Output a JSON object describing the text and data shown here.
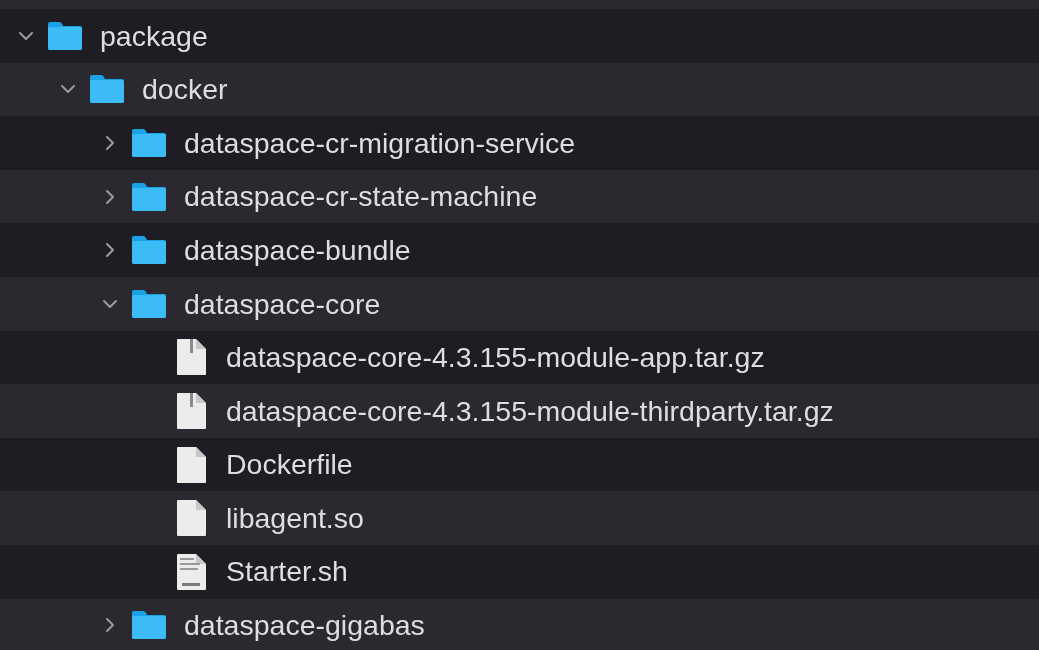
{
  "tree": [
    {
      "name": "package",
      "kind": "folder",
      "expanded": true,
      "children": [
        {
          "name": "docker",
          "kind": "folder",
          "expanded": true,
          "children": [
            {
              "name": "dataspace-cr-migration-service",
              "kind": "folder",
              "expanded": false
            },
            {
              "name": "dataspace-cr-state-machine",
              "kind": "folder",
              "expanded": false
            },
            {
              "name": "dataspace-bundle",
              "kind": "folder",
              "expanded": false
            },
            {
              "name": "dataspace-core",
              "kind": "folder",
              "expanded": true,
              "children": [
                {
                  "name": "dataspace-core-4.3.155-module-app.tar.gz",
                  "kind": "archive"
                },
                {
                  "name": "dataspace-core-4.3.155-module-thirdparty.tar.gz",
                  "kind": "archive"
                },
                {
                  "name": "Dockerfile",
                  "kind": "file"
                },
                {
                  "name": "libagent.so",
                  "kind": "file"
                },
                {
                  "name": "Starter.sh",
                  "kind": "script"
                }
              ]
            },
            {
              "name": "dataspace-gigabas",
              "kind": "folder",
              "expanded": false
            }
          ]
        }
      ]
    }
  ]
}
